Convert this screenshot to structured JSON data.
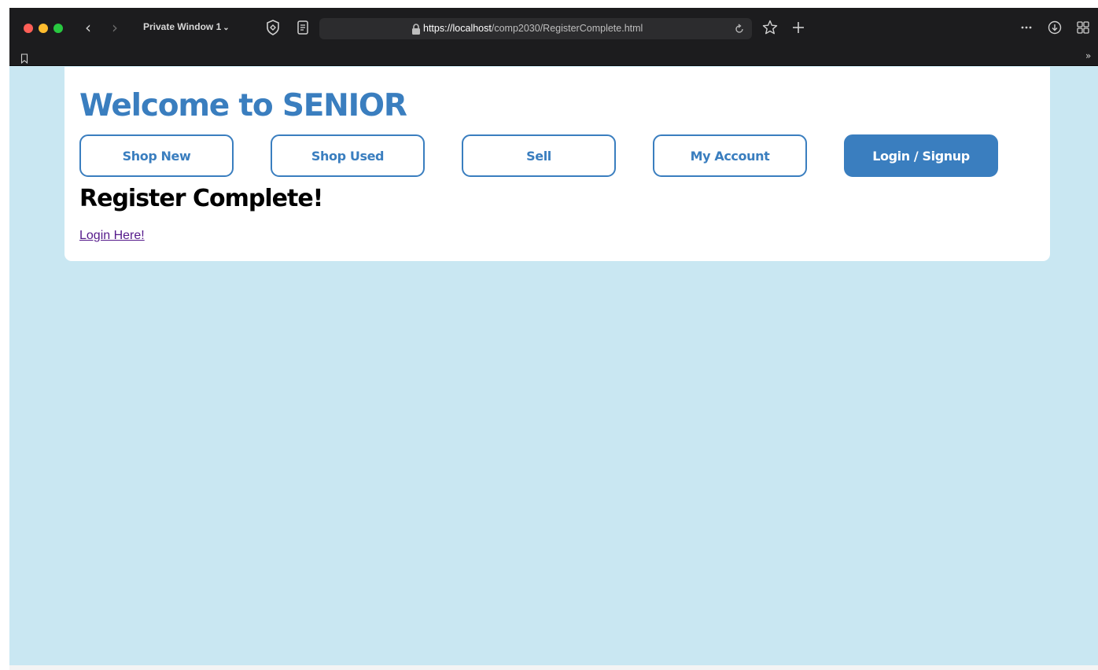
{
  "browser": {
    "window_label": "Private Window 1",
    "url": {
      "host": "https://localhost",
      "path": "/comp2030/RegisterComplete.html"
    },
    "accent_colors": {
      "close": "#fe5f57",
      "minimize": "#febc2e",
      "maximize": "#28c840"
    },
    "icons": {
      "back": "chevron-left-icon",
      "forward": "chevron-right-icon",
      "privacy": "privacy-report-icon",
      "reader": "reader-icon",
      "lock": "lock-icon",
      "reload": "reload-icon",
      "star": "star-icon",
      "new_tab": "plus-icon",
      "more": "more-icon",
      "downloads": "download-icon",
      "tab_overview": "grid-icon",
      "bookmark": "bookmark-icon",
      "overflow": "overflow-icon"
    }
  },
  "site": {
    "title": "Welcome to SENIOR",
    "nav": [
      {
        "label": "Shop New",
        "primary": false
      },
      {
        "label": "Shop Used",
        "primary": false
      },
      {
        "label": "Sell",
        "primary": false
      },
      {
        "label": "My Account",
        "primary": false
      },
      {
        "label": "Login / Signup",
        "primary": true
      }
    ],
    "heading": "Register Complete!",
    "link_text": "Login Here!",
    "colors": {
      "brand": "#3a7ebf",
      "page_background": "#c9e7f2",
      "visited_link": "#551a8b"
    }
  }
}
